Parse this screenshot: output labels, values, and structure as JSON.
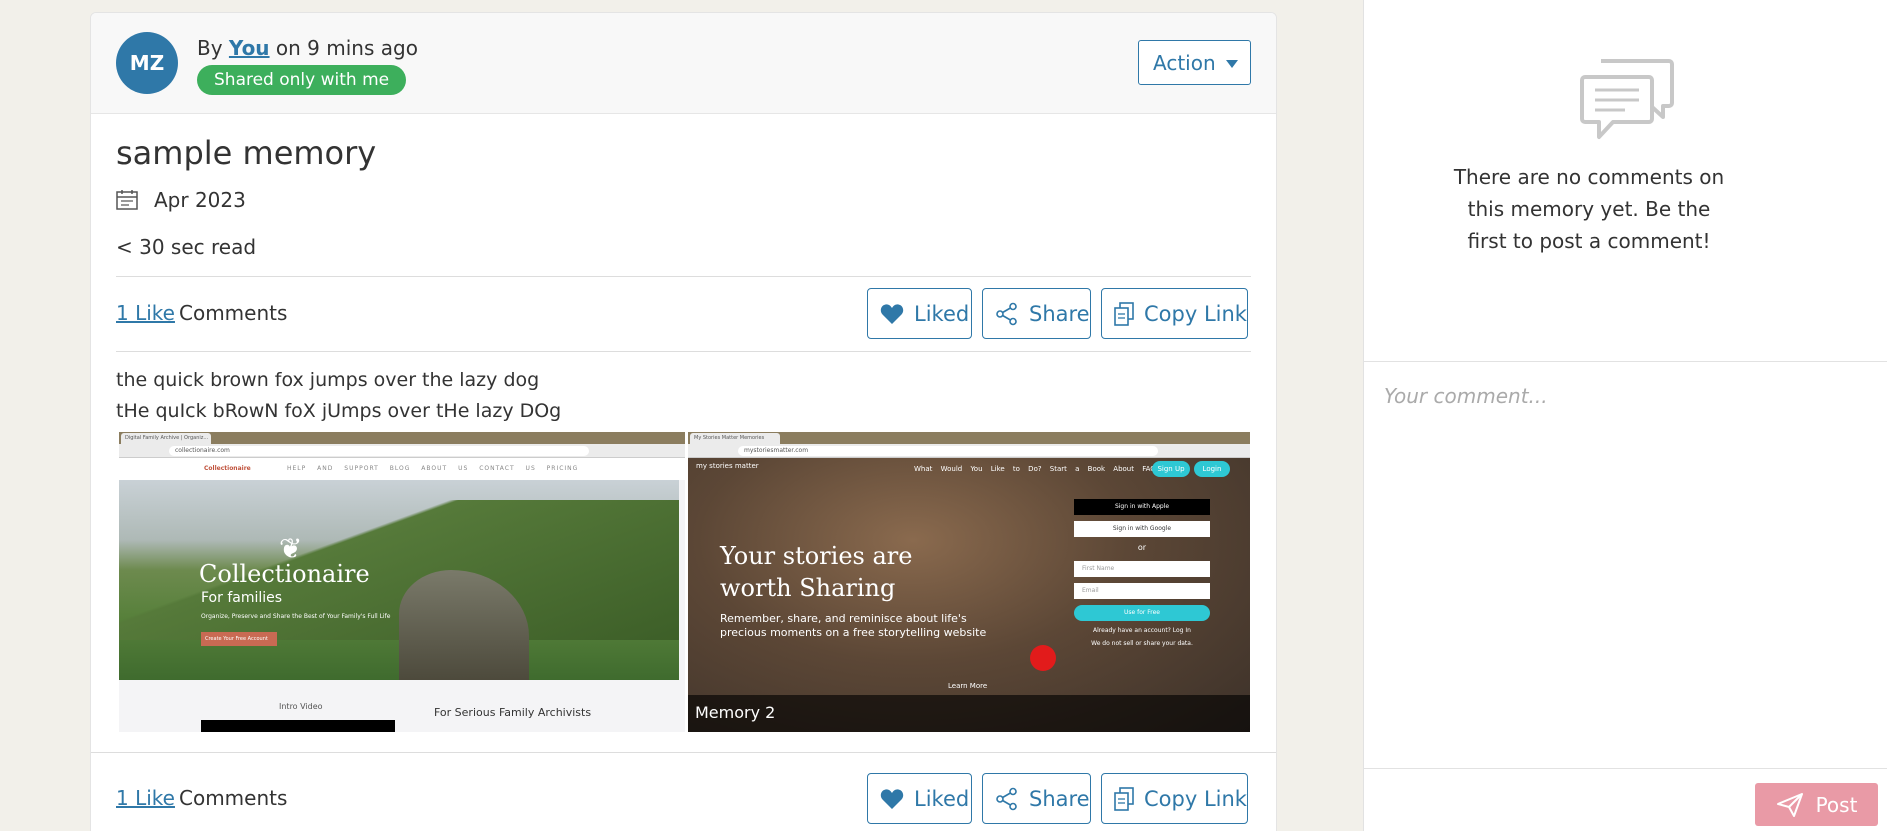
{
  "author": {
    "initials": "MZ",
    "prefix": "By",
    "name": "You",
    "suffix": "on 9 mins ago"
  },
  "visibility_badge": "Shared only with me",
  "action_label": "Action",
  "memory": {
    "title": "sample memory",
    "date": "Apr 2023",
    "read_time": "< 30 sec read",
    "body": [
      "the quick brown fox jumps over the lazy dog",
      "tHe quIck bRowN foX jUmps over tHe lazy DOg"
    ]
  },
  "engagement": {
    "likes_label": "1 Like",
    "comments_label": "Comments",
    "liked_label": "Liked",
    "share_label": "Share",
    "copy_link_label": "Copy Link"
  },
  "gallery": {
    "image1": {
      "tab": "Digital Family Archive | Organiz...",
      "url": "collectionaire.com",
      "logo": "Collectionaire",
      "nav": "HELP AND SUPPORT  BLOG  ABOUT US  CONTACT US  PRICING",
      "brand": "Collectionaire",
      "subtitle": "For families",
      "tagline": "Organize, Preserve and Share the Best of Your Family's Full Life",
      "cta": "Create Your Free Account",
      "intro": "Intro Video",
      "section": "For Serious Family Archivists"
    },
    "image2": {
      "tab": "My Stories Matter Memories",
      "url": "mystoriesmatter.com",
      "logo": "my stories matter",
      "nav": "What Would You Like to Do?  Start a Book  About  FAQs  Blog",
      "signup": "Sign Up",
      "login": "Login",
      "headline_1": "Your stories are",
      "headline_2": "worth Sharing",
      "subline": "Remember, share, and reminisce about life's precious moments on a free storytelling website",
      "apple": "Sign in with Apple",
      "google": "Sign in with Google",
      "or": "or",
      "first_name": "First Name",
      "email": "Email",
      "use_free": "Use for Free",
      "already": "Already have an account? Log In",
      "privacy": "We do not sell or share your data.",
      "learn_more": "Learn More",
      "caption": "Memory 2"
    }
  },
  "sidebar": {
    "empty_message": "There are no comments on this memory yet. Be the first to post a comment!",
    "comment_placeholder": "Your comment...",
    "post_label": "Post"
  },
  "colors": {
    "accent": "#2f78a8",
    "badge_green": "#3daf5c",
    "post_pink": "#e99aa6",
    "background": "#f2f0ea"
  }
}
